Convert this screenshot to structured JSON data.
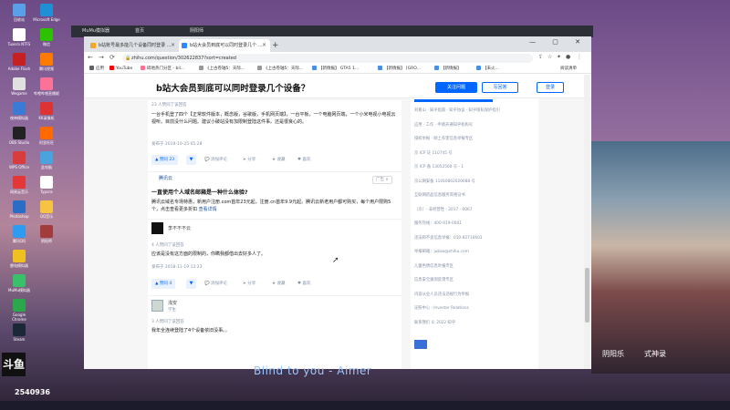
{
  "desktop": {
    "icons": [
      {
        "label": "回收站",
        "color": "#5aa0e8"
      },
      {
        "label": "Tuxera NTFS",
        "color": "#ffffff"
      },
      {
        "label": "Adobe Flash",
        "color": "#c62020"
      },
      {
        "label": "Wegame",
        "color": "#e0e0e0"
      },
      {
        "label": "夜神模拟器",
        "color": "#3b7bd6"
      },
      {
        "label": "OBS Studio",
        "color": "#222222"
      },
      {
        "label": "WPS Office",
        "color": "#d93c3c"
      },
      {
        "label": "网易云音乐",
        "color": "#e23838"
      },
      {
        "label": "Photoshop",
        "color": "#2b6cc7"
      },
      {
        "label": "腾讯QQ",
        "color": "#2f9bf0"
      },
      {
        "label": "雷电模拟器",
        "color": "#f0c020"
      },
      {
        "label": "MuMu模拟器",
        "color": "#3abf6b"
      },
      {
        "label": "Google Chrome",
        "color": "#2aa84a"
      },
      {
        "label": "Steam",
        "color": "#1b2838"
      },
      {
        "label": "Microsoft Edge",
        "color": "#1f8fd6"
      },
      {
        "label": "微信",
        "color": "#2dc100"
      },
      {
        "label": "腾讯视频",
        "color": "#ff7a00"
      },
      {
        "label": "哔哩哔哩直播姬",
        "color": "#fb7299"
      },
      {
        "label": "KK录像机",
        "color": "#dd3333"
      },
      {
        "label": "阿里旺旺",
        "color": "#ff6a00"
      },
      {
        "label": "此电脑",
        "color": "#4aa3df"
      },
      {
        "label": "Typora",
        "color": "#ffffff"
      },
      {
        "label": "QQ音乐",
        "color": "#f6c342"
      },
      {
        "label": "阴阳师",
        "color": "#a23b3b"
      }
    ],
    "streamer": {
      "logo": "斗鱼",
      "room": "2540936"
    },
    "caption": "Blind to you - Aimer"
  },
  "mumu": {
    "title": "MuMu模拟器",
    "tabs": [
      "首页",
      "阴阳师"
    ]
  },
  "browser": {
    "tabs": [
      {
        "title": "b站账号最多能几个设备同时登录 ..."
      },
      {
        "title": "b站大会员到底可以同时登录几个 ..."
      }
    ],
    "new_tab": "+",
    "window_controls": "— ▢ ✕",
    "url": "zhihu.com/question/302622837?sort=created",
    "bookmarks": [
      {
        "label": "应用",
        "color": "#5f6368"
      },
      {
        "label": "YouTube",
        "color": "#ff0000"
      },
      {
        "label": "碎地热门分区 - bil...",
        "color": "#fb7299"
      },
      {
        "label": "《上古卷轴5：天际...",
        "color": "#999999"
      },
      {
        "label": "《上古卷轴5：天际...",
        "color": "#999999"
      },
      {
        "label": "【新情报】 GTA5 1...",
        "color": "#4a90e2"
      },
      {
        "label": "【新情报】 [GRO...",
        "color": "#4a90e2"
      },
      {
        "label": "【新情报】",
        "color": "#4a90e2"
      },
      {
        "label": "【未火...",
        "color": "#4a90e2"
      }
    ],
    "reading_list": "阅读清单"
  },
  "page": {
    "question_title": "b站大会员到底可以同时登录几个设备？",
    "follow_btn": "关注问题",
    "write_btn": "写回答",
    "login_btn": "登录",
    "answers": [
      {
        "votes_meta": "23 人赞同了该回答",
        "text": "一台手机登了四个【正常软件版本，概念版，谷歌版，手机网页端】，一台平板，一个电脑网页端，一个小米电视小电视云视听。目前没什么问题。建议小破站没有加限制登陆这件事。还是很良心的。",
        "date": "发布于 2019-10-25 05:28",
        "vote_label": "▲ 赞同 23",
        "down": "▼",
        "comment": "添加评论",
        "share": "分享",
        "fav": "收藏",
        "like": "喜欢"
      },
      {
        "sponsor": "腾讯云",
        "ad_tag": "广告 ∨",
        "title": "一直使用个人域名邮箱是一种什么体验?",
        "text": "腾讯云域名专场特惠，新用户注册.com首年23元起，注册.cn首年9.9元起。腾讯云新老用户都可购买，每个用户限购5个，点击查看更多折扣",
        "more": "查看详情"
      },
      {
        "author": "李不不不云",
        "votes_meta": "4 人赞同了该回答",
        "text": "应该是没有这方面的限制的，你瞒我都借出去好多人了。",
        "date": "发布于 2018-11-19 13:23",
        "vote_label": "▲ 赞同 4",
        "down": "▼",
        "comment": "添加评论",
        "share": "分享",
        "fav": "收藏",
        "like": "喜欢"
      },
      {
        "author": "浅安",
        "author_sub": "学生",
        "votes_meta": "3 人赞同了该回答",
        "text": "我年全连续登陆了4个设备依旧没事。。"
      }
    ],
    "sidebar_lines": [
      "刘看山 · 知乎指南 · 知乎协议 · 知乎隐私保护指引",
      "应用 · 工作 · 申请开通知乎机构号",
      "侵权举报 · 网上有害信息举报专区",
      "京 ICP 证 110745 号",
      "京 ICP 备 13052560 号 - 1",
      "京公网安备 11010802020088 号",
      "互联网药品信息服务资格证书",
      "（京）- 非经营性 - 2017 - 0067",
      "服务热线：400-919-0001",
      "违法和不良信息举报：010-82716601",
      "举报邮箱：jubao@zhihu.com",
      "儿童色情信息举报专区",
      "信息安全漏洞反馈专区",
      "内容从业人员违法违规行为举报",
      "证照中心 · Investor Relations",
      "联系我们 © 2022 知乎"
    ],
    "to_top": "⬆"
  },
  "game": {
    "left_label": "阴阳乐",
    "right_label": "式神录"
  }
}
